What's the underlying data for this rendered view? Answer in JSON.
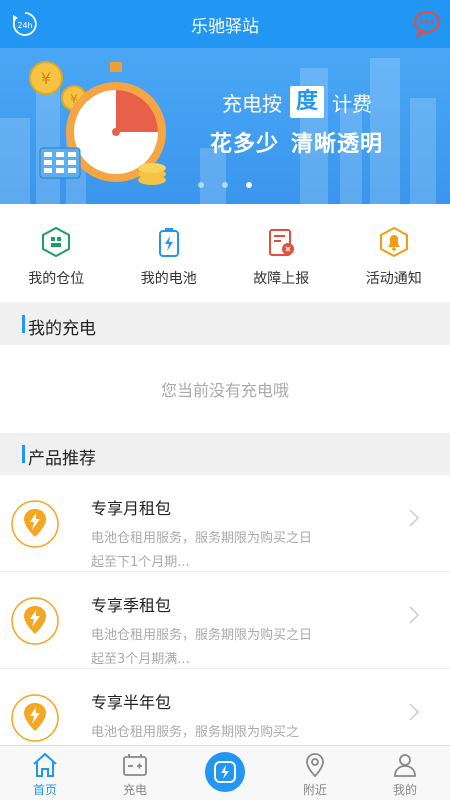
{
  "header": {
    "title": "乐驰驿站",
    "left_icon": "24h-clock-icon",
    "right_icon": "chat-bubble-icon"
  },
  "banner": {
    "line1_pre": "充电按",
    "line1_box": "度",
    "line1_post": "计费",
    "line2_a": "花多少",
    "line2_b": "清晰透明",
    "dots_total": 3,
    "dots_active": 3
  },
  "quick_actions": [
    {
      "label": "我的仓位",
      "icon": "locker-icon",
      "color": "#1e9e63"
    },
    {
      "label": "我的电池",
      "icon": "battery-icon",
      "color": "#2196f3"
    },
    {
      "label": "故障上报",
      "icon": "report-icon",
      "color": "#e84c3d"
    },
    {
      "label": "活动通知",
      "icon": "bell-icon",
      "color": "#f39c12"
    }
  ],
  "my_charging": {
    "title": "我的充电",
    "empty_text": "您当前没有充电哦"
  },
  "recommend": {
    "title": "产品推荐",
    "items": [
      {
        "name": "专享月租包",
        "desc": "电池仓租用服务，服务期限为购买之日起至下1个月期..."
      },
      {
        "name": "专享季租包",
        "desc": "电池仓租用服务，服务期限为购买之日起至3个月期满..."
      },
      {
        "name": "专享半年包",
        "desc": "电池仓租用服务，服务期限为购买之"
      }
    ]
  },
  "tabbar": {
    "items": [
      {
        "label": "首页",
        "icon": "home-icon",
        "active": true
      },
      {
        "label": "充电",
        "icon": "battery-charge-icon",
        "active": false
      },
      {
        "label": "",
        "icon": "lightning-icon",
        "active": false
      },
      {
        "label": "附近",
        "icon": "location-pin-icon",
        "active": false
      },
      {
        "label": "我的",
        "icon": "user-icon",
        "active": false
      }
    ]
  },
  "colors": {
    "primary": "#2196f3",
    "pin_orange": "#f5a623",
    "chat_red": "#e74c3c"
  }
}
